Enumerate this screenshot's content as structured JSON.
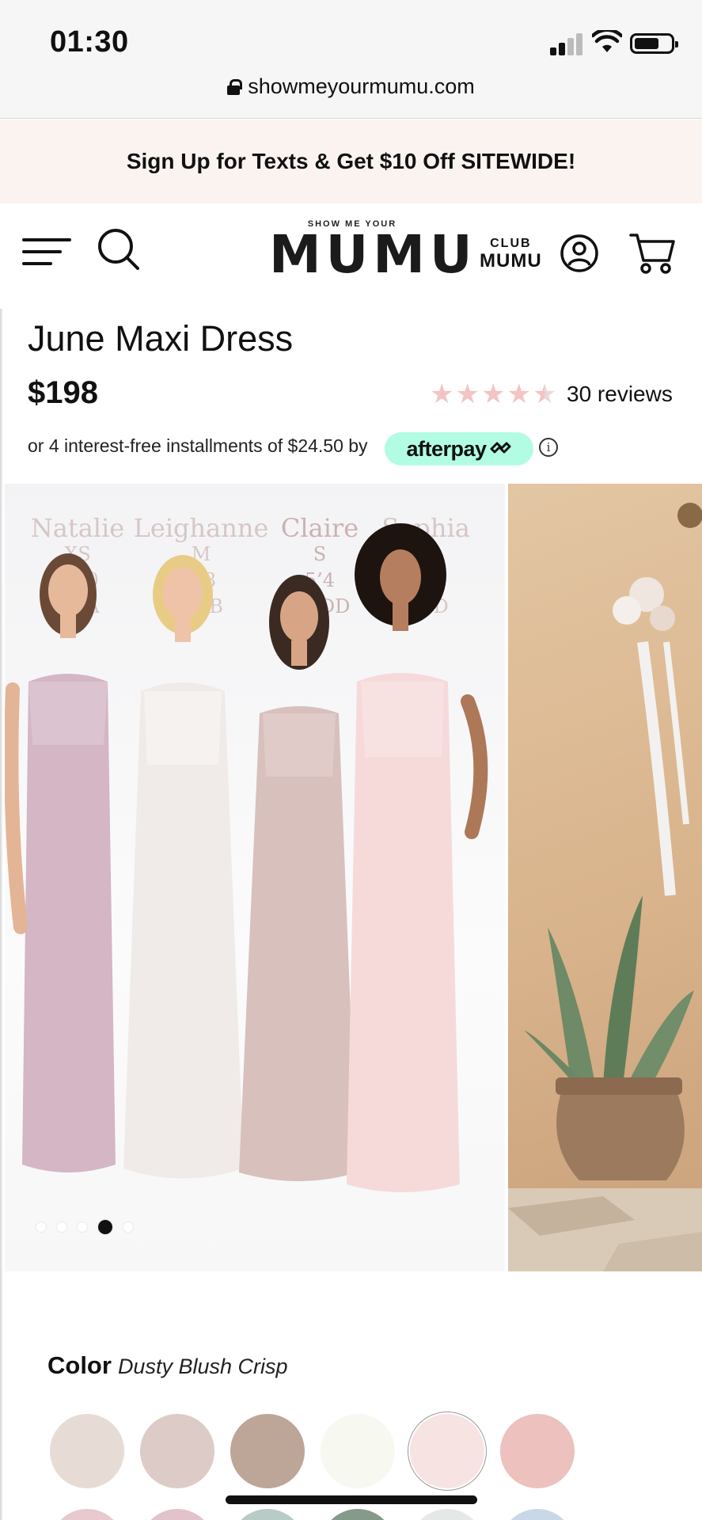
{
  "status_bar": {
    "time": "01:30",
    "url": "showmeyourmumu.com",
    "icons": [
      "signal-icon",
      "wifi-icon",
      "battery-icon",
      "lock-icon"
    ]
  },
  "promo": {
    "text": "Sign Up for Texts & Get $10 Off SITEWIDE!"
  },
  "header": {
    "logo_small": "SHOW ME YOUR",
    "logo_big": "MUMU",
    "club_top": "CLUB",
    "club_bottom": "MUMU",
    "icons": [
      "menu-icon",
      "search-icon",
      "account-icon",
      "cart-icon"
    ]
  },
  "product": {
    "title": "June Maxi Dress",
    "price": "$198",
    "rating": 4.5,
    "rating_max": 5,
    "reviews": "30 reviews",
    "installments_text": "or 4 interest-free installments of $24.50 by",
    "afterpay_label": "afterpay",
    "info_glyph": "i"
  },
  "gallery": {
    "models": [
      {
        "name": "Natalie",
        "size": "XS",
        "height": "5’10",
        "bust": "32 A"
      },
      {
        "name": "Leighanne",
        "size": "M",
        "height": "5’8",
        "bust": "34 B"
      },
      {
        "name": "Claire",
        "size": "S",
        "height": "5’4",
        "bust": "34 DD"
      },
      {
        "name": "Sophia",
        "size": "L",
        "height": "5’9",
        "bust": "36 D"
      }
    ],
    "slide_count": 5,
    "active_slide": 4
  },
  "color": {
    "label": "Color",
    "selected": "Dusty Blush Crisp",
    "swatches": [
      "#e6dcd5",
      "#dccbc6",
      "#bda598",
      "#f7f8ef",
      "#f7e4e2",
      "#ecc1be"
    ],
    "swatches_row2": [
      "#e8c9cd",
      "#e2c2cb",
      "#b9cbc6",
      "#869a8a",
      "#e4e9e7",
      "#c8d8e6"
    ]
  },
  "colors": {
    "promo_bg": "#fbf3ef",
    "afterpay_bg": "#b2fce4",
    "star": "#f4c4c4"
  }
}
